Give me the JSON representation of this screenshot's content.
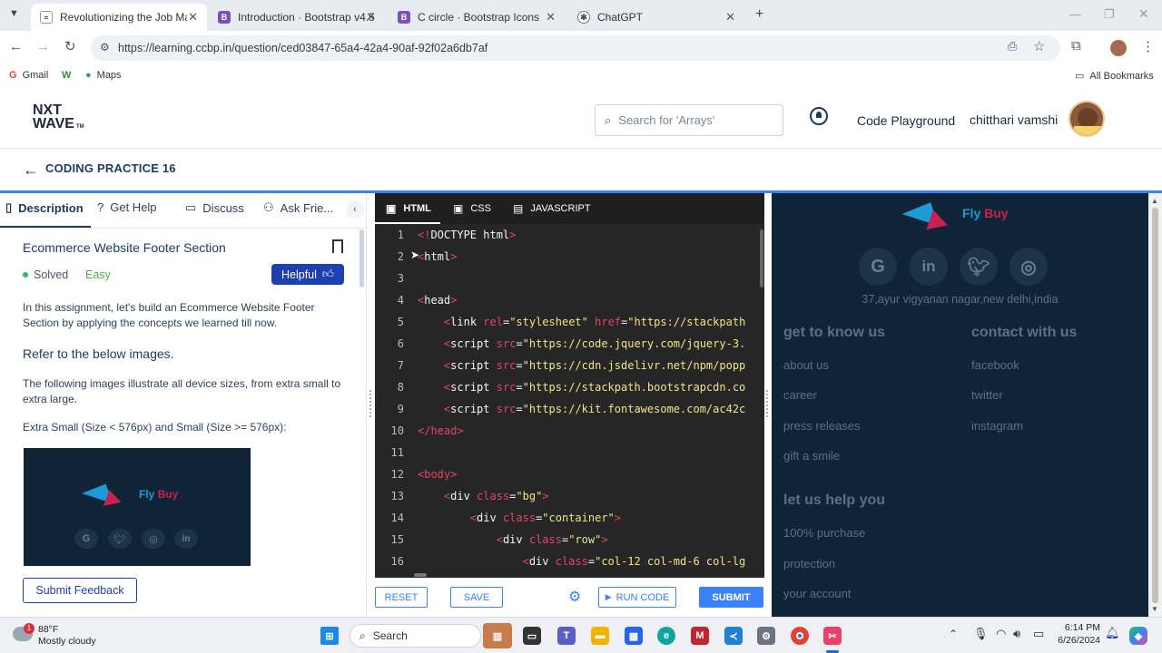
{
  "browser": {
    "tabs": [
      {
        "label": "Revolutionizing the Job Market",
        "icon": "nxtwave-favicon-icon"
      },
      {
        "label": "Introduction · Bootstrap v4.5",
        "icon": "bootstrap-icon"
      },
      {
        "label": "C circle · Bootstrap Icons",
        "icon": "bootstrap-icon"
      },
      {
        "label": "ChatGPT",
        "icon": "chatgpt-icon"
      }
    ],
    "url": "https://learning.ccbp.in/question/ced03847-65a4-42a4-90af-92f02a6db7af",
    "bookmarks": [
      "Gmail",
      "Maps"
    ],
    "all_bookmarks": "All Bookmarks"
  },
  "header": {
    "logo_line1": "NXT",
    "logo_line2": "WAVE",
    "logo_tm": "TM",
    "search_placeholder": "Search for 'Arrays'",
    "code_playground": "Code Playground",
    "user_name": "chitthari vamshi"
  },
  "subheader": {
    "title": "CODING PRACTICE 16"
  },
  "left_tabs": [
    {
      "label": "Description",
      "icon": "description-icon"
    },
    {
      "label": "Get Help",
      "icon": "help-icon"
    },
    {
      "label": "Discuss",
      "icon": "discuss-icon"
    },
    {
      "label": "Ask Frie...",
      "icon": "ask-friends-icon"
    }
  ],
  "problem": {
    "title": "Ecommerce Website Footer Section",
    "status": "Solved",
    "difficulty": "Easy",
    "helpful": "Helpful",
    "intro": "In this assignment, let's build an Ecommerce Website Footer Section by applying the concepts we learned till now.",
    "refer": "Refer to the below images.",
    "illustrate": "The following images illustrate all device sizes, from extra small to extra large.",
    "size_label": "Extra Small (Size < 576px) and Small (Size >= 576px):",
    "image_brand_fly": "Fly",
    "image_brand_buy": "Buy",
    "submit_feedback": "Submit Feedback"
  },
  "editor": {
    "tabs": [
      "HTML",
      "CSS",
      "JAVASCRIPT"
    ],
    "lines": [
      {
        "n": "1",
        "parts": [
          [
            "tg",
            "<!"
          ],
          [
            "",
            "DOCTYPE html"
          ],
          [
            "tg",
            ">"
          ]
        ]
      },
      {
        "n": "2",
        "parts": [
          [
            "tg",
            "<"
          ],
          [
            "",
            "html"
          ],
          [
            "tg",
            ">"
          ]
        ]
      },
      {
        "n": "3",
        "parts": []
      },
      {
        "n": "4",
        "parts": [
          [
            "tg",
            "<"
          ],
          [
            "",
            "head"
          ],
          [
            "tg",
            ">"
          ]
        ]
      },
      {
        "n": "5",
        "parts": [
          [
            "",
            "    "
          ],
          [
            "tg",
            "<"
          ],
          [
            "",
            "link "
          ],
          [
            "at",
            "rel"
          ],
          [
            "",
            "="
          ],
          [
            "st",
            "\"stylesheet\""
          ],
          [
            "",
            " "
          ],
          [
            "at",
            "href"
          ],
          [
            "",
            "="
          ],
          [
            "st",
            "\"https://stackpath"
          ]
        ]
      },
      {
        "n": "6",
        "parts": [
          [
            "",
            "    "
          ],
          [
            "tg",
            "<"
          ],
          [
            "",
            "script "
          ],
          [
            "at",
            "src"
          ],
          [
            "",
            "="
          ],
          [
            "st",
            "\"https://code.jquery.com/jquery-3."
          ]
        ]
      },
      {
        "n": "7",
        "parts": [
          [
            "",
            "    "
          ],
          [
            "tg",
            "<"
          ],
          [
            "",
            "script "
          ],
          [
            "at",
            "src"
          ],
          [
            "",
            "="
          ],
          [
            "st",
            "\"https://cdn.jsdelivr.net/npm/popp"
          ]
        ]
      },
      {
        "n": "8",
        "parts": [
          [
            "",
            "    "
          ],
          [
            "tg",
            "<"
          ],
          [
            "",
            "script "
          ],
          [
            "at",
            "src"
          ],
          [
            "",
            "="
          ],
          [
            "st",
            "\"https://stackpath.bootstrapcdn.co"
          ]
        ]
      },
      {
        "n": "9",
        "parts": [
          [
            "",
            "    "
          ],
          [
            "tg",
            "<"
          ],
          [
            "",
            "script "
          ],
          [
            "at",
            "src"
          ],
          [
            "",
            "="
          ],
          [
            "st",
            "\"https://kit.fontawesome.com/ac42c"
          ]
        ]
      },
      {
        "n": "10",
        "parts": [
          [
            "tg",
            "</"
          ],
          [
            "tg",
            "head"
          ],
          [
            "tg",
            ">"
          ]
        ]
      },
      {
        "n": "11",
        "parts": []
      },
      {
        "n": "12",
        "parts": [
          [
            "tg",
            "<"
          ],
          [
            "tg",
            "body"
          ],
          [
            "tg",
            ">"
          ]
        ]
      },
      {
        "n": "13",
        "parts": [
          [
            "",
            "    "
          ],
          [
            "tg",
            "<"
          ],
          [
            "",
            "div "
          ],
          [
            "at",
            "class"
          ],
          [
            "",
            "="
          ],
          [
            "st",
            "\"bg\""
          ],
          [
            "tg",
            ">"
          ]
        ]
      },
      {
        "n": "14",
        "parts": [
          [
            "",
            "        "
          ],
          [
            "tg",
            "<"
          ],
          [
            "",
            "div "
          ],
          [
            "at",
            "class"
          ],
          [
            "",
            "="
          ],
          [
            "st",
            "\"container\""
          ],
          [
            "tg",
            ">"
          ]
        ]
      },
      {
        "n": "15",
        "parts": [
          [
            "",
            "            "
          ],
          [
            "tg",
            "<"
          ],
          [
            "",
            "div "
          ],
          [
            "at",
            "class"
          ],
          [
            "",
            "="
          ],
          [
            "st",
            "\"row\""
          ],
          [
            "tg",
            ">"
          ]
        ]
      },
      {
        "n": "16",
        "parts": [
          [
            "",
            "                "
          ],
          [
            "tg",
            "<"
          ],
          [
            "",
            "div "
          ],
          [
            "at",
            "class"
          ],
          [
            "",
            "="
          ],
          [
            "st",
            "\"col-12 col-md-6 col-lg"
          ]
        ]
      }
    ],
    "reset": "RESET",
    "save": "SAVE",
    "run_code": "RUN CODE",
    "submit": "SUBMIT"
  },
  "preview": {
    "brand_fly": "Fly",
    "brand_buy": "Buy",
    "address": "37,ayur vigyanan nagar,new delhi,india",
    "col1_heading": "get to know us",
    "col1_links": [
      "about us",
      "career",
      "press releases",
      "gift a smile"
    ],
    "col2_heading": "contact with us",
    "col2_links": [
      "facebook",
      "twitter",
      "instagram"
    ],
    "col3_heading": "let us help you",
    "col3_links": [
      "100% purchase",
      "protection",
      "your account"
    ]
  },
  "taskbar": {
    "weather_temp": "88°F",
    "weather_desc": "Mostly cloudy",
    "notification_count": "1",
    "search": "Search",
    "time": "6:14 PM",
    "date": "6/26/2024"
  },
  "colors": {
    "accent": "#3b82f6",
    "editor_bg": "#262626",
    "preview_bg": "#0f2537",
    "solved_green": "#22c55e",
    "easy_green": "#4caf50",
    "helpful_blue": "#1e40af"
  }
}
